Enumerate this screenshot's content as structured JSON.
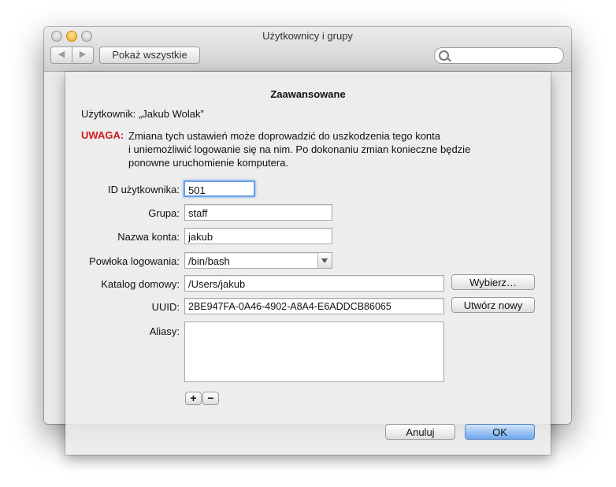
{
  "window": {
    "title": "Użytkownicy i grupy",
    "nav_back": "◀",
    "nav_forward": "▶",
    "show_all_label": "Pokaż wszystkie",
    "search_placeholder": ""
  },
  "sheet": {
    "title": "Zaawansowane",
    "user_line": "Użytkownik: „Jakub Wolak”",
    "warning_label": "UWAGA:",
    "warning_text_lines": [
      "Zmiana tych ustawień może doprowadzić do uszkodzenia tego konta",
      "i uniemożliwić logowanie się na nim. Po dokonaniu zmian konieczne będzie",
      "ponowne uruchomienie komputera."
    ],
    "fields": {
      "user_id": {
        "label": "ID użytkownika:",
        "value": "501"
      },
      "group": {
        "label": "Grupa:",
        "value": "staff"
      },
      "account_name": {
        "label": "Nazwa konta:",
        "value": "jakub"
      },
      "login_shell": {
        "label": "Powłoka logowania:",
        "value": "/bin/bash"
      },
      "home_dir": {
        "label": "Katalog domowy:",
        "value": "/Users/jakub"
      },
      "uuid": {
        "label": "UUID:",
        "value": "2BE947FA-0A46-4902-A8A4-E6ADDCB86065"
      },
      "aliases": {
        "label": "Aliasy:",
        "items": []
      }
    },
    "buttons": {
      "choose": "Wybierz…",
      "create_new": "Utwórz nowy",
      "add": "+",
      "remove": "−",
      "cancel": "Anuluj",
      "ok": "OK"
    }
  }
}
